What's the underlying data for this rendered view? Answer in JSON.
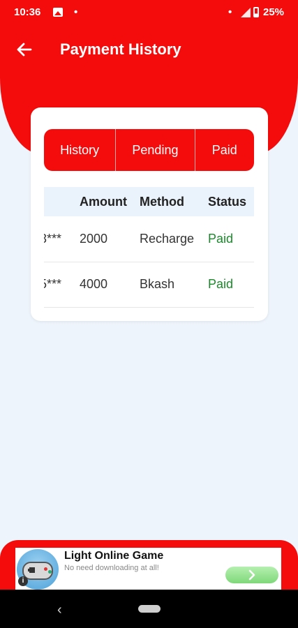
{
  "status_bar": {
    "time": "10:36",
    "dot_left": "•",
    "dot_right": "•",
    "battery": "25%",
    "icons": [
      "image-icon",
      "signal-icon",
      "battery-icon"
    ]
  },
  "header": {
    "title": "Payment History",
    "back_icon": "arrow-left-icon"
  },
  "tabs": [
    {
      "label": "History"
    },
    {
      "label": "Pending"
    },
    {
      "label": "Paid"
    }
  ],
  "table": {
    "columns": [
      "Amount",
      "Method",
      "Status"
    ],
    "rows": [
      {
        "id": "3***",
        "amount": "2000",
        "method": "Recharge",
        "status": "Paid"
      },
      {
        "id": "5***",
        "amount": "4000",
        "method": "Bkash",
        "status": "Paid"
      }
    ]
  },
  "ad": {
    "title": "Light Online Game",
    "subtitle": "No need downloading at all!",
    "info": "i",
    "icon": "gamepad-icon",
    "button_icon": "chevron-right-icon"
  },
  "colors": {
    "primary": "#f40c0c",
    "background": "#eef4fb",
    "paid": "#1a8a2a"
  }
}
